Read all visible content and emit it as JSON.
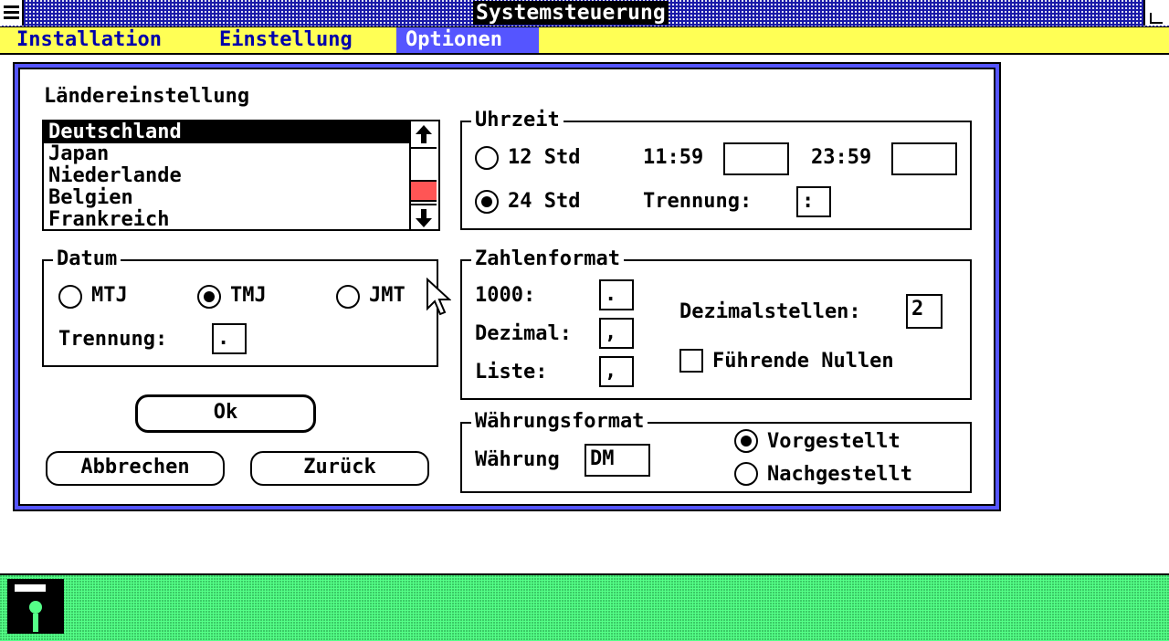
{
  "window": {
    "title": "Systemsteuerung"
  },
  "menu": {
    "items": [
      "Installation",
      "Einstellung",
      "Optionen"
    ],
    "active": "Optionen"
  },
  "country": {
    "label": "Ländereinstellung",
    "items": [
      "Deutschland",
      "Japan",
      "Niederlande",
      "Belgien",
      "Frankreich"
    ],
    "selected": "Deutschland",
    "scroll_up_icon": "arrow-up-icon",
    "scroll_down_icon": "arrow-down-icon"
  },
  "date": {
    "title": "Datum",
    "options": [
      "MTJ",
      "TMJ",
      "JMT"
    ],
    "selected": "TMJ",
    "separator_label": "Trennung:",
    "separator_value": "."
  },
  "buttons": {
    "ok": "Ok",
    "cancel": "Abbrechen",
    "back": "Zurück"
  },
  "time": {
    "title": "Uhrzeit",
    "opt12": "12 Std",
    "opt24": "24 Std",
    "selected": "24 Std",
    "am_label": "11:59",
    "am_value": "",
    "pm_label": "23:59",
    "pm_value": "",
    "separator_label": "Trennung:",
    "separator_value": ":"
  },
  "number": {
    "title": "Zahlenformat",
    "thousands_label": "1000:",
    "thousands_value": ".",
    "decimal_label": "Dezimal:",
    "decimal_value": ",",
    "list_label": "Liste:",
    "list_value": ",",
    "decimals_label": "Dezimalstellen:",
    "decimals_value": "2",
    "leading_zeros_label": "Führende Nullen",
    "leading_zeros_checked": false
  },
  "currency": {
    "title": "Währungsformat",
    "label": "Währung",
    "value": "DM",
    "prefix_label": "Vorgestellt",
    "suffix_label": "Nachgestellt",
    "selected": "Vorgestellt"
  },
  "colors": {
    "title_bar": "#1a1aa8",
    "menu_bar": "#ffff55",
    "menu_active": "#5555ff",
    "desktop": "#55ff88",
    "scroll_thumb": "#ff5555"
  },
  "icons": {
    "system_menu": "system-menu-icon",
    "drive": "disk-drive-icon",
    "cursor": "mouse-pointer-icon"
  }
}
